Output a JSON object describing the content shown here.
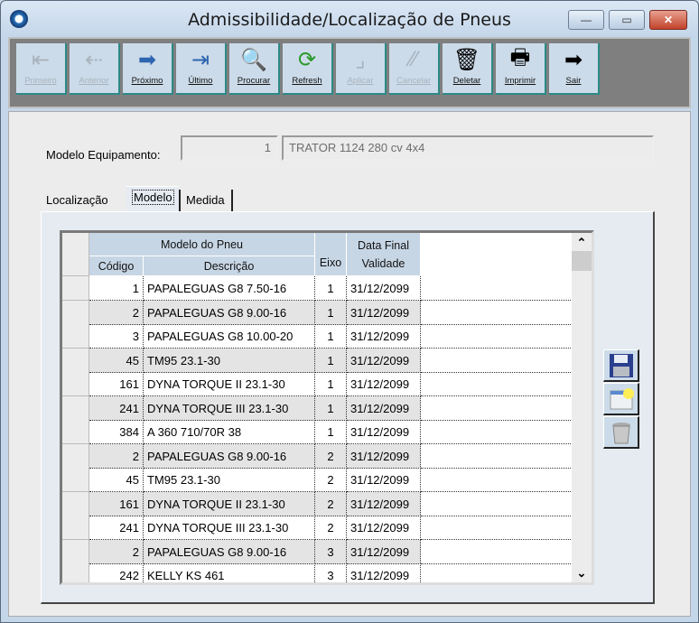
{
  "window": {
    "title": "Admissibilidade/Localização de Pneus",
    "minimize": "—",
    "maximize": "▭",
    "close": "✕"
  },
  "toolbar": [
    {
      "label": "Primeiro",
      "icon": "first-icon",
      "glyph": "⇤",
      "enabled": false
    },
    {
      "label": "Anterior",
      "icon": "previous-icon",
      "glyph": "⇠",
      "enabled": false
    },
    {
      "label": "Próximo",
      "icon": "next-arrow-icon",
      "glyph": "➡",
      "enabled": true
    },
    {
      "label": "Último",
      "icon": "last-arrow-icon",
      "glyph": "⇥",
      "enabled": true
    },
    {
      "label": "Procurar",
      "icon": "magnifier-icon",
      "glyph": "🔍",
      "enabled": true
    },
    {
      "label": "Refresh",
      "icon": "refresh-icon",
      "glyph": "⟳",
      "enabled": true
    },
    {
      "label": "Aplicar",
      "icon": "apply-icon",
      "glyph": "⌟",
      "enabled": false
    },
    {
      "label": "Cancelar",
      "icon": "cancel-icon",
      "glyph": "⁄⁄",
      "enabled": false
    },
    {
      "label": "Deletar",
      "icon": "trash-icon",
      "glyph": "🗑",
      "enabled": true
    },
    {
      "label": "Imprimir",
      "icon": "printer-icon",
      "glyph": "🖶",
      "enabled": true
    },
    {
      "label": "Sair",
      "icon": "exit-door-icon",
      "glyph": "➡",
      "enabled": true
    }
  ],
  "form": {
    "label": "Modelo Equipamento:",
    "code": "1",
    "description": "TRATOR 1124 280 cv 4x4"
  },
  "tabs": [
    {
      "label": "Localização"
    },
    {
      "label": "Modelo"
    },
    {
      "label": "Medida"
    }
  ],
  "grid": {
    "group_header": "Modelo do Pneu",
    "columns": {
      "codigo": "Código",
      "descricao": "Descrição",
      "eixo": "Eixo",
      "data_l1": "Data Final",
      "data_l2": "Validade"
    },
    "rows": [
      {
        "codigo": "1",
        "descricao": "PAPALEGUAS G8 7.50-16",
        "eixo": "1",
        "data": "31/12/2099"
      },
      {
        "codigo": "2",
        "descricao": "PAPALEGUAS G8 9.00-16",
        "eixo": "1",
        "data": "31/12/2099"
      },
      {
        "codigo": "3",
        "descricao": "PAPALEGUAS G8 10.00-20",
        "eixo": "1",
        "data": "31/12/2099"
      },
      {
        "codigo": "45",
        "descricao": "TM95 23.1-30",
        "eixo": "1",
        "data": "31/12/2099"
      },
      {
        "codigo": "161",
        "descricao": "DYNA TORQUE II 23.1-30",
        "eixo": "1",
        "data": "31/12/2099"
      },
      {
        "codigo": "241",
        "descricao": "DYNA TORQUE III 23.1-30",
        "eixo": "1",
        "data": "31/12/2099"
      },
      {
        "codigo": "384",
        "descricao": "A 360 710/70R 38",
        "eixo": "1",
        "data": "31/12/2099"
      },
      {
        "codigo": "2",
        "descricao": "PAPALEGUAS G8 9.00-16",
        "eixo": "2",
        "data": "31/12/2099"
      },
      {
        "codigo": "45",
        "descricao": "TM95 23.1-30",
        "eixo": "2",
        "data": "31/12/2099"
      },
      {
        "codigo": "161",
        "descricao": "DYNA TORQUE II 23.1-30",
        "eixo": "2",
        "data": "31/12/2099"
      },
      {
        "codigo": "241",
        "descricao": "DYNA TORQUE III 23.1-30",
        "eixo": "2",
        "data": "31/12/2099"
      },
      {
        "codigo": "2",
        "descricao": "PAPALEGUAS G8 9.00-16",
        "eixo": "3",
        "data": "31/12/2099"
      },
      {
        "codigo": "242",
        "descricao": "KELLY KS 461",
        "eixo": "3",
        "data": "31/12/2099"
      }
    ]
  },
  "scroll": {
    "up": "⌃",
    "down": "⌄"
  }
}
